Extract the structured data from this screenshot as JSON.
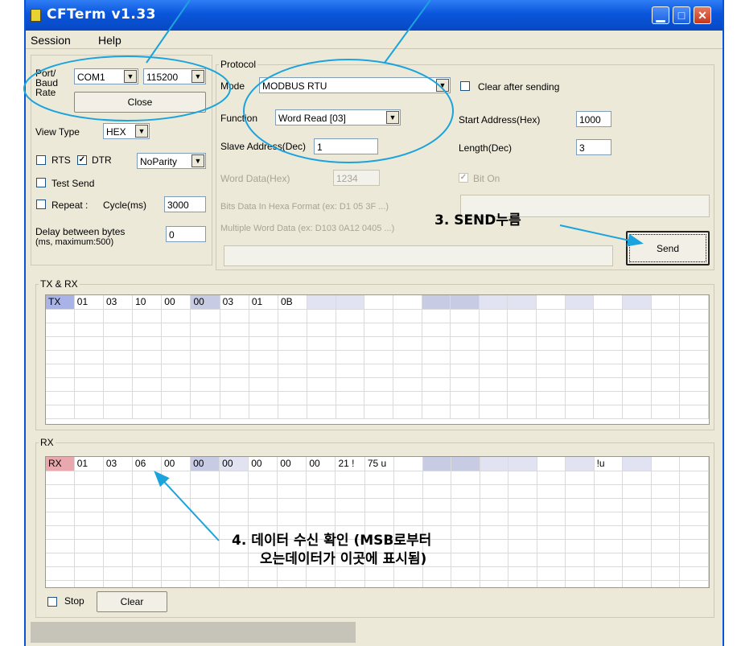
{
  "window": {
    "title": "CFTerm v1.33"
  },
  "menu": [
    "Session",
    "Help"
  ],
  "port": {
    "label_port": "Port/",
    "label_baud": "Baud",
    "label_rate": "Rate",
    "com": "COM1",
    "baud": "115200",
    "close_label": "Close"
  },
  "view": {
    "label": "View Type",
    "value": "HEX"
  },
  "signals": {
    "rts": "RTS",
    "dtr": "DTR",
    "parity": "NoParity"
  },
  "test_send": "Test Send",
  "repeat": {
    "label": "Repeat :",
    "cycle_label": "Cycle(ms)",
    "cycle_value": "3000"
  },
  "delay": {
    "label1": "Delay between bytes",
    "label2": "(ms, maximum:500)",
    "value": "0"
  },
  "protocol": {
    "title": "Protocol",
    "mode_label": "Mode",
    "mode_value": "MODBUS RTU",
    "clear_after": "Clear after sending",
    "function_label": "Function",
    "function_value": "Word Read [03]",
    "start_label": "Start Address(Hex)",
    "start_value": "1000",
    "slave_label": "Slave Address(Dec)",
    "slave_value": "1",
    "length_label": "Length(Dec)",
    "length_value": "3",
    "word_label": "Word Data(Hex)",
    "word_value": "1234",
    "bit_on": "Bit On",
    "bits_label": "Bits Data In Hexa Format (ex: D1 05 3F ...)",
    "multi_label": "Multiple Word Data (ex: D103 0A12 0405 ...)",
    "send_label": "Send"
  },
  "txrx": {
    "title": "TX & RX",
    "first_row": [
      "TX",
      "01",
      "03",
      "10",
      "00",
      "00",
      "03",
      "01",
      "0B",
      "",
      "",
      "",
      "",
      "",
      "",
      "",
      "",
      "",
      "",
      "",
      "",
      "",
      ""
    ]
  },
  "rx": {
    "title": "RX",
    "first_row": [
      "RX",
      "01",
      "03",
      "06",
      "00",
      "00",
      "00",
      "00",
      "00",
      "00",
      "21 !",
      "75 u",
      "",
      "",
      "",
      "",
      "",
      "",
      "",
      "!u",
      "",
      "",
      ""
    ],
    "stop_label": "Stop",
    "clear_label": "Clear"
  },
  "annotations": {
    "send": "3. SEND누름",
    "confirm_line1": "4. 데이터 수신 확인 (MSB로부터",
    "confirm_line2": "오는데이터가 이곳에 표시됨)"
  },
  "colors": {
    "tx_cell": "#a9b3e8",
    "rx_cell": "#e8a8ae",
    "highlight_a": "#c8cbe4",
    "highlight_b": "#e1e3f2",
    "annotation": "#1ba3dd"
  }
}
